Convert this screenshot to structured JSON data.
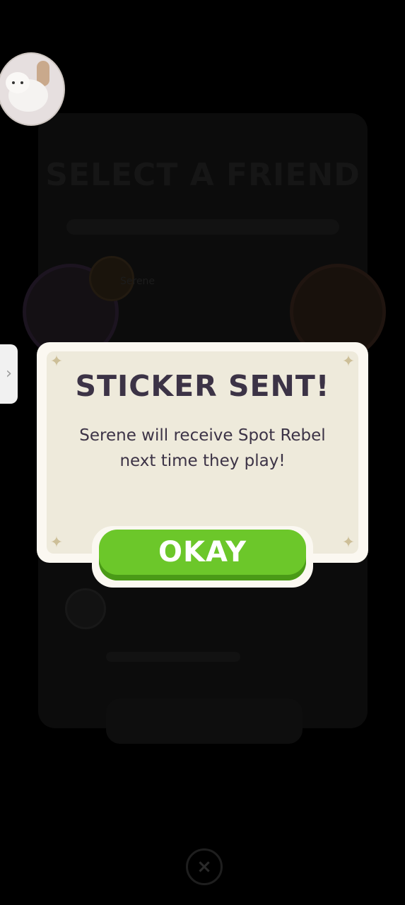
{
  "background": {
    "title": "SELECT A FRIEND",
    "friend_name": "Serene"
  },
  "modal": {
    "title": "STICKER SENT!",
    "message": "Serene will receive Spot Rebel next time they play!",
    "button_label": "OKAY"
  },
  "icons": {
    "close": "×",
    "side_tab": "›"
  },
  "colors": {
    "okay_green": "#6cc72a",
    "title_text": "#3c3346",
    "modal_bg": "#eeeadb"
  }
}
